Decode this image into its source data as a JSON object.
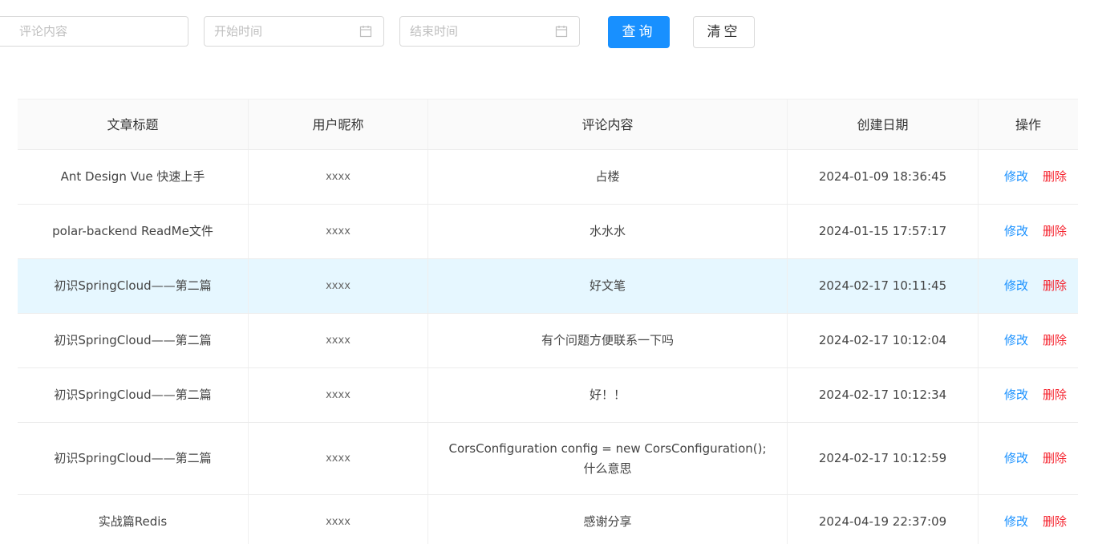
{
  "search": {
    "comment_placeholder": "评论内容",
    "start_placeholder": "开始时间",
    "end_placeholder": "结束时间",
    "query_label": "查询",
    "clear_label": "清空"
  },
  "table": {
    "headers": [
      "文章标题",
      "用户昵称",
      "评论内容",
      "创建日期",
      "操作"
    ],
    "rows": [
      {
        "title": "Ant Design Vue 快速上手",
        "nickname": "xxxx",
        "comment": "占楼",
        "comment2": "",
        "created": "2024-01-09 18:36:45",
        "edit": "修改",
        "delete": "删除"
      },
      {
        "title": "polar-backend ReadMe文件",
        "nickname": "xxxx",
        "comment": "水水水",
        "comment2": "",
        "created": "2024-01-15 17:57:17",
        "edit": "修改",
        "delete": "删除"
      },
      {
        "title": "初识SpringCloud——第二篇",
        "nickname": "xxxx",
        "comment": "好文笔",
        "comment2": "",
        "created": "2024-02-17 10:11:45",
        "edit": "修改",
        "delete": "删除"
      },
      {
        "title": "初识SpringCloud——第二篇",
        "nickname": "xxxx",
        "comment": "有个问题方便联系一下吗",
        "comment2": "",
        "created": "2024-02-17 10:12:04",
        "edit": "修改",
        "delete": "删除"
      },
      {
        "title": "初识SpringCloud——第二篇",
        "nickname": "xxxx",
        "comment": "好！！",
        "comment2": "",
        "created": "2024-02-17 10:12:34",
        "edit": "修改",
        "delete": "删除"
      },
      {
        "title": "初识SpringCloud——第二篇",
        "nickname": "xxxx",
        "comment": "CorsConfiguration config = new CorsConfiguration();",
        "comment2": "什么意思",
        "created": "2024-02-17 10:12:59",
        "edit": "修改",
        "delete": "删除"
      },
      {
        "title": "实战篇Redis",
        "nickname": "xxxx",
        "comment": "感谢分享",
        "comment2": "",
        "created": "2024-04-19 22:37:09",
        "edit": "修改",
        "delete": "删除"
      }
    ]
  },
  "colors": {
    "primary": "#1890ff",
    "danger": "#f5222d",
    "selected_row": "#e6f7ff",
    "header_bg": "#fafafa"
  },
  "icons": {
    "date_picker": "calendar-icon"
  }
}
